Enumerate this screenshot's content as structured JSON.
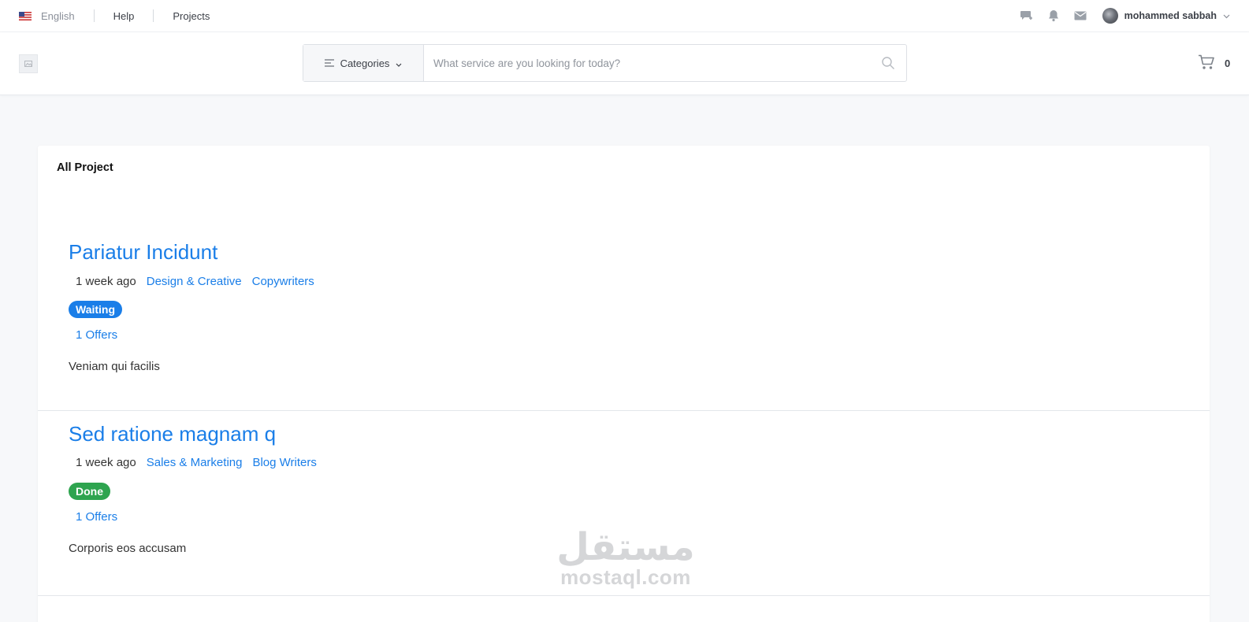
{
  "topbar": {
    "language": "English",
    "links": [
      "Help",
      "Projects"
    ],
    "icons": [
      "chat-add-icon",
      "bell-icon",
      "mail-icon"
    ],
    "user_name": "mohammed sabbah"
  },
  "header": {
    "categories_label": "Categories",
    "search_placeholder": "What service are you looking for today?",
    "cart_count": "0"
  },
  "main": {
    "section_title": "All Project",
    "projects": [
      {
        "title": "Pariatur Incidunt",
        "posted": "1 week ago",
        "category": "Design & Creative",
        "subcategory": "Copywriters",
        "status": "Waiting",
        "status_color": "#1a7ee8",
        "offers": "1 Offers",
        "description": "Veniam qui facilis"
      },
      {
        "title": "Sed ratione magnam q",
        "posted": "1 week ago",
        "category": "Sales & Marketing",
        "subcategory": "Blog Writers",
        "status": "Done",
        "status_color": "#2ea44f",
        "offers": "1 Offers",
        "description": "Corporis eos accusam"
      }
    ]
  },
  "watermark": {
    "arabic": "مستقل",
    "latin": "mostaql.com"
  },
  "colors": {
    "accent": "#1a7ee8",
    "success": "#2ea44f"
  }
}
